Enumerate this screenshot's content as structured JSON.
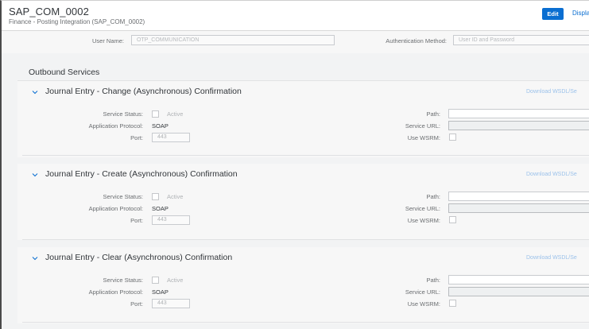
{
  "header": {
    "title": "SAP_COM_0002",
    "subtitle": "Finance - Posting Integration (SAP_COM_0002)",
    "edit_label": "Edit",
    "display_label": "Display"
  },
  "top_form": {
    "user_name_label": "User Name:",
    "user_name_value": "OTP_COMMUNICATION",
    "auth_method_label": "Authentication Method:",
    "auth_method_value": "User ID and Password"
  },
  "outbound": {
    "title": "Outbound Services",
    "services": [
      {
        "title": "Journal Entry - Change (Asynchronous) Confirmation",
        "download_label": "Download WSDL/Se",
        "status_label": "Service Status:",
        "status_value": "Active",
        "protocol_label": "Application Protocol:",
        "protocol_value": "SOAP",
        "port_label": "Port:",
        "port_value": "443",
        "path_label": "Path:",
        "service_url_label": "Service URL:",
        "wsrm_label": "Use WSRM:"
      },
      {
        "title": "Journal Entry - Create (Asynchronous) Confirmation",
        "download_label": "Download WSDL/Se",
        "status_label": "Service Status:",
        "status_value": "Active",
        "protocol_label": "Application Protocol:",
        "protocol_value": "SOAP",
        "port_label": "Port:",
        "port_value": "443",
        "path_label": "Path:",
        "service_url_label": "Service URL:",
        "wsrm_label": "Use WSRM:"
      },
      {
        "title": "Journal Entry - Clear (Asynchronous) Confirmation",
        "download_label": "Download WSDL/Se",
        "status_label": "Service Status:",
        "status_value": "Active",
        "protocol_label": "Application Protocol:",
        "protocol_value": "SOAP",
        "port_label": "Port:",
        "port_value": "443",
        "path_label": "Path:",
        "service_url_label": "Service URL:",
        "wsrm_label": "Use WSRM:"
      }
    ]
  },
  "icons": {
    "chevron": "chevron-down-icon"
  },
  "colors": {
    "accent": "#0a6ed1",
    "link_disabled": "#9cc2ea",
    "background": "#f2f3f4"
  }
}
